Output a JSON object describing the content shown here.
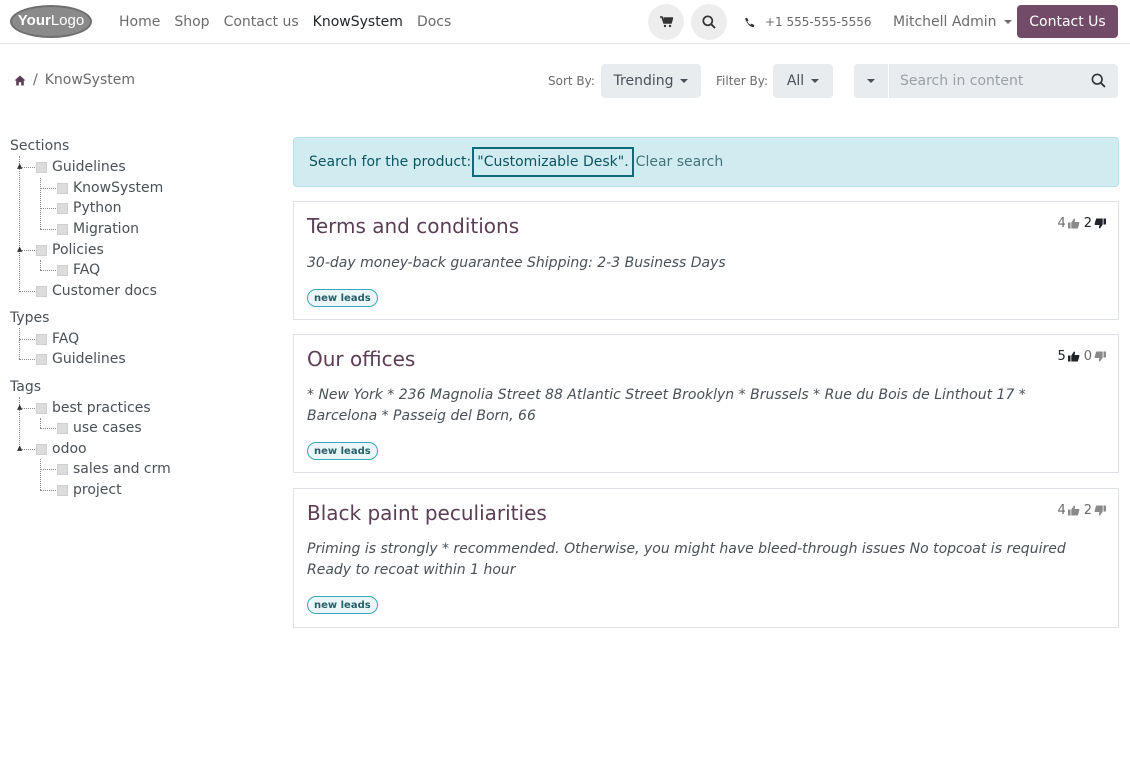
{
  "header": {
    "logo": {
      "part1": "Your",
      "part2": "Logo"
    },
    "nav": [
      {
        "label": "Home"
      },
      {
        "label": "Shop"
      },
      {
        "label": "Contact us"
      },
      {
        "label": "KnowSystem",
        "active": true
      },
      {
        "label": "Docs"
      }
    ],
    "phone": "+1 555-555-5556",
    "user": "Mitchell Admin",
    "contact_button": "Contact Us",
    "icons": {
      "cart": "cart-icon",
      "search": "search-icon",
      "phone": "phone-icon"
    }
  },
  "toolbar": {
    "breadcrumb_current": "KnowSystem",
    "sort_label": "Sort By:",
    "sort_value": "Trending",
    "filter_label": "Filter By:",
    "filter_value": "All",
    "search_placeholder": "Search in content"
  },
  "sidebar": {
    "sections_title": "Sections",
    "sections": {
      "guidelines": "Guidelines",
      "knowsystem": "KnowSystem",
      "python": "Python",
      "migration": "Migration",
      "policies": "Policies",
      "faq": "FAQ",
      "customer_docs": "Customer docs"
    },
    "types_title": "Types",
    "types": {
      "faq": "FAQ",
      "guidelines": "Guidelines"
    },
    "tags_title": "Tags",
    "tags": {
      "best_practices": "best practices",
      "use_cases": "use cases",
      "odoo": "odoo",
      "sales_crm": "sales and crm",
      "project": "project"
    }
  },
  "alert": {
    "prefix": "Search for the product:",
    "query": "\"Customizable Desk\".",
    "clear": "Clear search"
  },
  "articles": [
    {
      "title": "Terms and conditions",
      "likes": "4",
      "dislikes": "2",
      "description": "30-day money-back guarantee Shipping: 2-3 Business Days",
      "tag": "new leads"
    },
    {
      "title": "Our offices",
      "likes": "5",
      "dislikes": "0",
      "description": "* New York * 236 Magnolia Street 88 Atlantic Street Brooklyn * Brussels * Rue du Bois de Linthout 17 * Barcelona * Passeig del Born, 66",
      "tag": "new leads"
    },
    {
      "title": "Black paint peculiarities",
      "likes": "4",
      "dislikes": "2",
      "description": "Priming is strongly * recommended. Otherwise, you might have bleed-through issues No topcoat is required Ready to recoat within 1 hour",
      "tag": "new leads"
    }
  ],
  "colors": {
    "brand": "#714b67",
    "alert_bg": "#d1ecf1",
    "title": "#5b3e56"
  }
}
